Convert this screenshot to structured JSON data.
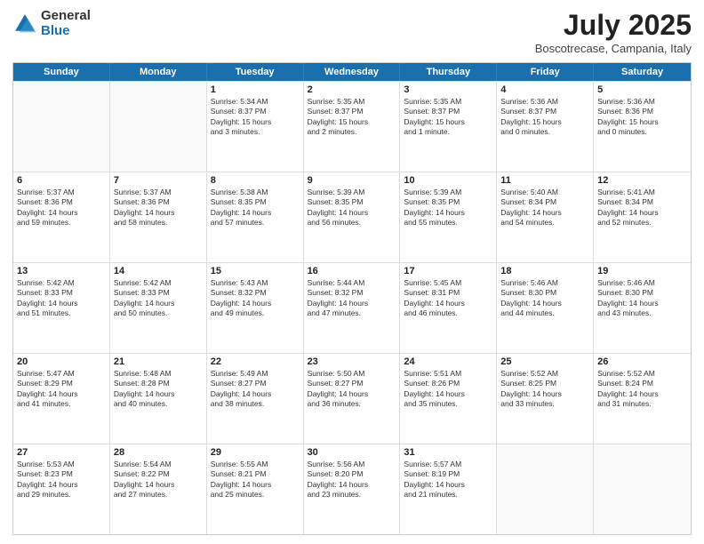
{
  "logo": {
    "general": "General",
    "blue": "Blue"
  },
  "title": {
    "month": "July 2025",
    "location": "Boscotrecase, Campania, Italy"
  },
  "days_of_week": [
    "Sunday",
    "Monday",
    "Tuesday",
    "Wednesday",
    "Thursday",
    "Friday",
    "Saturday"
  ],
  "weeks": [
    [
      {
        "day": "",
        "info": ""
      },
      {
        "day": "",
        "info": ""
      },
      {
        "day": "1",
        "info": "Sunrise: 5:34 AM\nSunset: 8:37 PM\nDaylight: 15 hours\nand 3 minutes."
      },
      {
        "day": "2",
        "info": "Sunrise: 5:35 AM\nSunset: 8:37 PM\nDaylight: 15 hours\nand 2 minutes."
      },
      {
        "day": "3",
        "info": "Sunrise: 5:35 AM\nSunset: 8:37 PM\nDaylight: 15 hours\nand 1 minute."
      },
      {
        "day": "4",
        "info": "Sunrise: 5:36 AM\nSunset: 8:37 PM\nDaylight: 15 hours\nand 0 minutes."
      },
      {
        "day": "5",
        "info": "Sunrise: 5:36 AM\nSunset: 8:36 PM\nDaylight: 15 hours\nand 0 minutes."
      }
    ],
    [
      {
        "day": "6",
        "info": "Sunrise: 5:37 AM\nSunset: 8:36 PM\nDaylight: 14 hours\nand 59 minutes."
      },
      {
        "day": "7",
        "info": "Sunrise: 5:37 AM\nSunset: 8:36 PM\nDaylight: 14 hours\nand 58 minutes."
      },
      {
        "day": "8",
        "info": "Sunrise: 5:38 AM\nSunset: 8:35 PM\nDaylight: 14 hours\nand 57 minutes."
      },
      {
        "day": "9",
        "info": "Sunrise: 5:39 AM\nSunset: 8:35 PM\nDaylight: 14 hours\nand 56 minutes."
      },
      {
        "day": "10",
        "info": "Sunrise: 5:39 AM\nSunset: 8:35 PM\nDaylight: 14 hours\nand 55 minutes."
      },
      {
        "day": "11",
        "info": "Sunrise: 5:40 AM\nSunset: 8:34 PM\nDaylight: 14 hours\nand 54 minutes."
      },
      {
        "day": "12",
        "info": "Sunrise: 5:41 AM\nSunset: 8:34 PM\nDaylight: 14 hours\nand 52 minutes."
      }
    ],
    [
      {
        "day": "13",
        "info": "Sunrise: 5:42 AM\nSunset: 8:33 PM\nDaylight: 14 hours\nand 51 minutes."
      },
      {
        "day": "14",
        "info": "Sunrise: 5:42 AM\nSunset: 8:33 PM\nDaylight: 14 hours\nand 50 minutes."
      },
      {
        "day": "15",
        "info": "Sunrise: 5:43 AM\nSunset: 8:32 PM\nDaylight: 14 hours\nand 49 minutes."
      },
      {
        "day": "16",
        "info": "Sunrise: 5:44 AM\nSunset: 8:32 PM\nDaylight: 14 hours\nand 47 minutes."
      },
      {
        "day": "17",
        "info": "Sunrise: 5:45 AM\nSunset: 8:31 PM\nDaylight: 14 hours\nand 46 minutes."
      },
      {
        "day": "18",
        "info": "Sunrise: 5:46 AM\nSunset: 8:30 PM\nDaylight: 14 hours\nand 44 minutes."
      },
      {
        "day": "19",
        "info": "Sunrise: 5:46 AM\nSunset: 8:30 PM\nDaylight: 14 hours\nand 43 minutes."
      }
    ],
    [
      {
        "day": "20",
        "info": "Sunrise: 5:47 AM\nSunset: 8:29 PM\nDaylight: 14 hours\nand 41 minutes."
      },
      {
        "day": "21",
        "info": "Sunrise: 5:48 AM\nSunset: 8:28 PM\nDaylight: 14 hours\nand 40 minutes."
      },
      {
        "day": "22",
        "info": "Sunrise: 5:49 AM\nSunset: 8:27 PM\nDaylight: 14 hours\nand 38 minutes."
      },
      {
        "day": "23",
        "info": "Sunrise: 5:50 AM\nSunset: 8:27 PM\nDaylight: 14 hours\nand 36 minutes."
      },
      {
        "day": "24",
        "info": "Sunrise: 5:51 AM\nSunset: 8:26 PM\nDaylight: 14 hours\nand 35 minutes."
      },
      {
        "day": "25",
        "info": "Sunrise: 5:52 AM\nSunset: 8:25 PM\nDaylight: 14 hours\nand 33 minutes."
      },
      {
        "day": "26",
        "info": "Sunrise: 5:52 AM\nSunset: 8:24 PM\nDaylight: 14 hours\nand 31 minutes."
      }
    ],
    [
      {
        "day": "27",
        "info": "Sunrise: 5:53 AM\nSunset: 8:23 PM\nDaylight: 14 hours\nand 29 minutes."
      },
      {
        "day": "28",
        "info": "Sunrise: 5:54 AM\nSunset: 8:22 PM\nDaylight: 14 hours\nand 27 minutes."
      },
      {
        "day": "29",
        "info": "Sunrise: 5:55 AM\nSunset: 8:21 PM\nDaylight: 14 hours\nand 25 minutes."
      },
      {
        "day": "30",
        "info": "Sunrise: 5:56 AM\nSunset: 8:20 PM\nDaylight: 14 hours\nand 23 minutes."
      },
      {
        "day": "31",
        "info": "Sunrise: 5:57 AM\nSunset: 8:19 PM\nDaylight: 14 hours\nand 21 minutes."
      },
      {
        "day": "",
        "info": ""
      },
      {
        "day": "",
        "info": ""
      }
    ]
  ]
}
